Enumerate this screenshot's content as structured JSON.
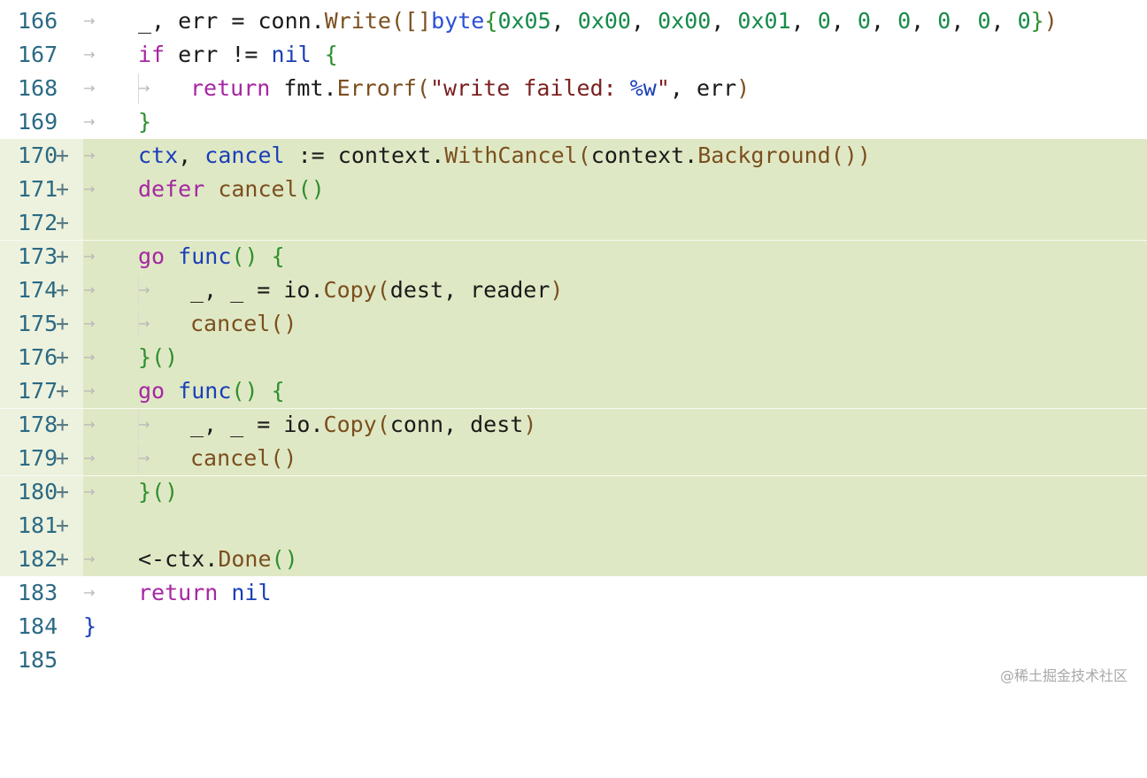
{
  "colors": {
    "added_line_bg": "#dfe8c4",
    "added_gutter_bg": "#edf2de",
    "line_number": "#2b6a84",
    "keyword": "#a626a4",
    "type": "#2b4fd6",
    "number": "#178a4a",
    "function": "#7b4f1f",
    "string": "#7a1f1f"
  },
  "lines": [
    {
      "num": "166",
      "added": false,
      "tokens": [
        "_, err = conn.",
        "Write",
        "(",
        "[]",
        "byte",
        "{",
        "0x05",
        ", ",
        "0x00",
        ", ",
        "0x00",
        ", ",
        "0x01",
        ", ",
        "0",
        ", ",
        "0",
        ", ",
        "0",
        ", ",
        "0",
        ", ",
        "0",
        ", ",
        "0",
        "}",
        ")"
      ]
    },
    {
      "num": "167",
      "added": false,
      "tokens": [
        "if",
        " err != ",
        "nil",
        " ",
        "{"
      ]
    },
    {
      "num": "168",
      "added": false,
      "tokens": [
        "return",
        " fmt.",
        "Errorf",
        "(",
        "\"write failed: ",
        "%w",
        "\"",
        ", err",
        ")"
      ]
    },
    {
      "num": "169",
      "added": false,
      "tokens": [
        "}"
      ]
    },
    {
      "num": "170",
      "added": true,
      "plus": "+",
      "tokens": [
        "ctx",
        ", ",
        "cancel",
        " := context.",
        "WithCancel",
        "(",
        "context.",
        "Background",
        "()",
        ")"
      ]
    },
    {
      "num": "171",
      "added": true,
      "plus": "+",
      "tokens": [
        "defer",
        " ",
        "cancel",
        "()"
      ]
    },
    {
      "num": "172",
      "added": true,
      "plus": "+",
      "tokens": []
    },
    {
      "num": "173",
      "added": true,
      "plus": "+",
      "tokens": [
        "go",
        " ",
        "func",
        "()",
        " ",
        "{"
      ]
    },
    {
      "num": "174",
      "added": true,
      "plus": "+",
      "tokens": [
        "_, _ = io.",
        "Copy",
        "(",
        "dest, reader",
        ")"
      ]
    },
    {
      "num": "175",
      "added": true,
      "plus": "+",
      "tokens": [
        "cancel",
        "()"
      ]
    },
    {
      "num": "176",
      "added": true,
      "plus": "+",
      "tokens": [
        "}",
        "()"
      ]
    },
    {
      "num": "177",
      "added": true,
      "plus": "+",
      "tokens": [
        "go",
        " ",
        "func",
        "()",
        " ",
        "{"
      ]
    },
    {
      "num": "178",
      "added": true,
      "plus": "+",
      "tokens": [
        "_, _ = io.",
        "Copy",
        "(",
        "conn, dest",
        ")"
      ]
    },
    {
      "num": "179",
      "added": true,
      "plus": "+",
      "tokens": [
        "cancel",
        "()"
      ]
    },
    {
      "num": "180",
      "added": true,
      "plus": "+",
      "tokens": [
        "}",
        "()"
      ]
    },
    {
      "num": "181",
      "added": true,
      "plus": "+",
      "tokens": []
    },
    {
      "num": "182",
      "added": true,
      "plus": "+",
      "tokens": [
        "<-ctx.",
        "Done",
        "()"
      ]
    },
    {
      "num": "183",
      "added": false,
      "tokens": [
        "return",
        " ",
        "nil"
      ]
    },
    {
      "num": "184",
      "added": false,
      "tokens": [
        "}"
      ]
    },
    {
      "num": "185",
      "added": false,
      "tokens": []
    }
  ],
  "arrow_glyph": "→",
  "indent_arrow_glyph": "↳",
  "watermark": "@稀土掘金技术社区"
}
